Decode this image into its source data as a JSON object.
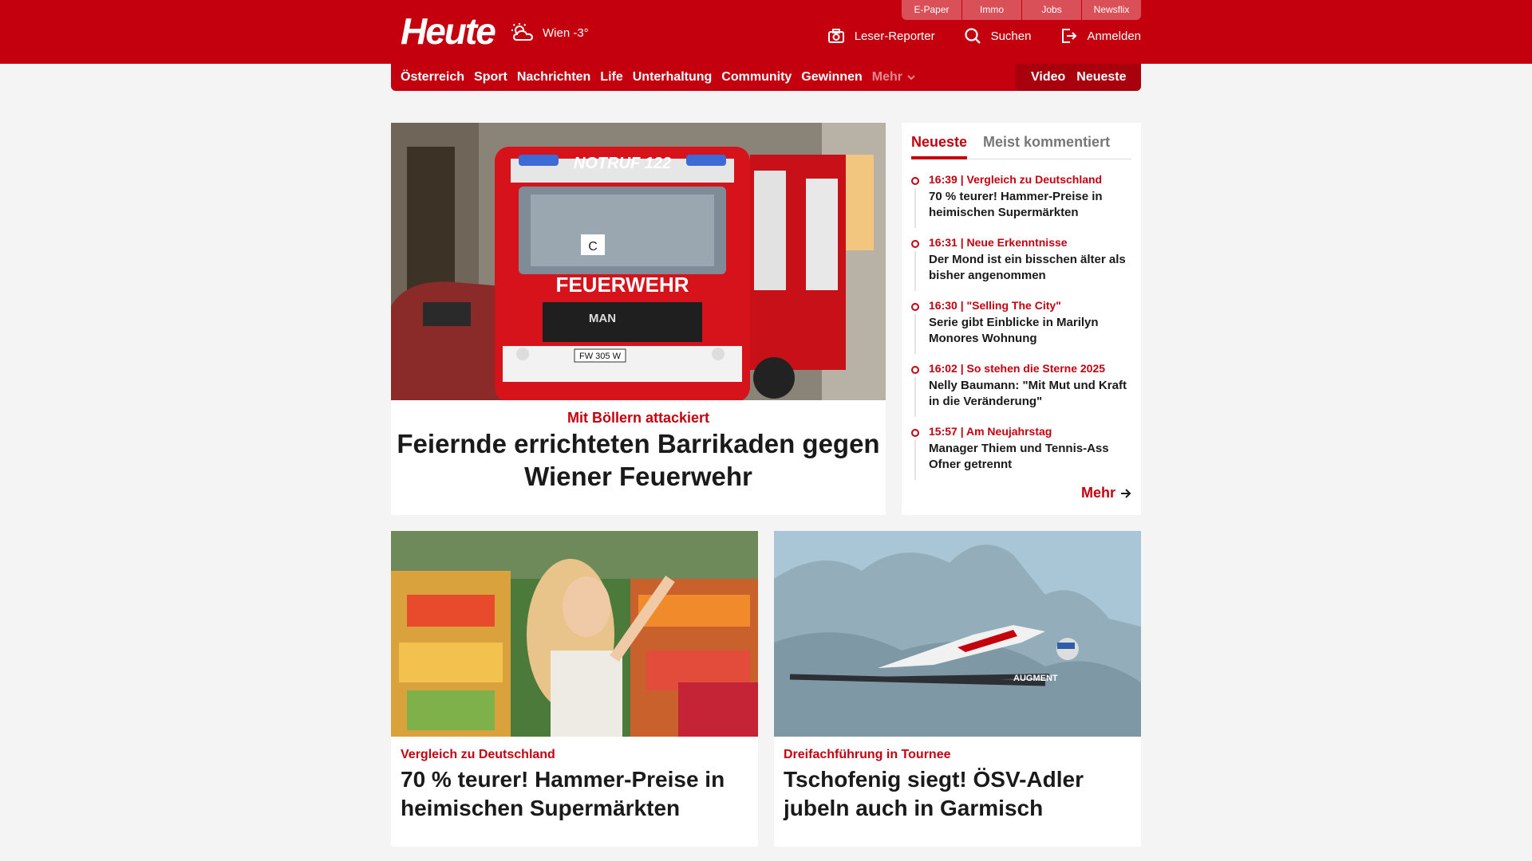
{
  "header": {
    "logo": "Heute",
    "weather": "Wien -3°",
    "utility_links": [
      "E-Paper",
      "Immo",
      "Jobs",
      "Newsflix"
    ],
    "actions": {
      "reporter": "Leser-Reporter",
      "search": "Suchen",
      "login": "Anmelden"
    }
  },
  "nav": {
    "items": [
      "Österreich",
      "Sport",
      "Nachrichten",
      "Life",
      "Unterhaltung",
      "Community",
      "Gewinnen"
    ],
    "more": "Mehr",
    "right": [
      "Video",
      "Neueste"
    ]
  },
  "hero": {
    "kicker": "Mit Böllern attackiert",
    "title": "Feiernde errichteten Barrikaden gegen Wiener Feuerwehr",
    "image_text": {
      "sign": "NOTRUF 122",
      "badge": "FEUERWEHR",
      "brand": "MAN",
      "plate": "FW 305 W",
      "letter": "C"
    }
  },
  "sidebar": {
    "tabs": [
      "Neueste",
      "Meist kommentiert"
    ],
    "items": [
      {
        "meta": "16:39 | Vergleich zu Deutschland",
        "title": "70 % teurer! Hammer-Preise in heimischen Supermärkten"
      },
      {
        "meta": "16:31 | Neue Erkenntnisse",
        "title": "Der Mond ist ein bisschen älter als bisher angenommen"
      },
      {
        "meta": "16:30 | \"Selling The City\"",
        "title": "Serie gibt Einblicke in Marilyn Monores Wohnung"
      },
      {
        "meta": "16:02 | So stehen die Sterne 2025",
        "title": "Nelly Baumann: \"Mit Mut und Kraft in die Veränderung\""
      },
      {
        "meta": "15:57 | Am Neujahrstag",
        "title": "Manager Thiem und Tennis-Ass Ofner getrennt"
      }
    ],
    "more": "Mehr"
  },
  "cards": [
    {
      "kicker": "Vergleich zu Deutschland",
      "title": "70 % teurer! Hammer-Preise in heimischen Supermärkten"
    },
    {
      "kicker": "Dreifachführung in Tournee",
      "title": "Tschofenig siegt! ÖSV-Adler jubeln auch in Garmisch",
      "image_text": "AUGMENT"
    }
  ],
  "colors": {
    "brand_red": "#c4000f",
    "background": "#f4f4f4"
  }
}
